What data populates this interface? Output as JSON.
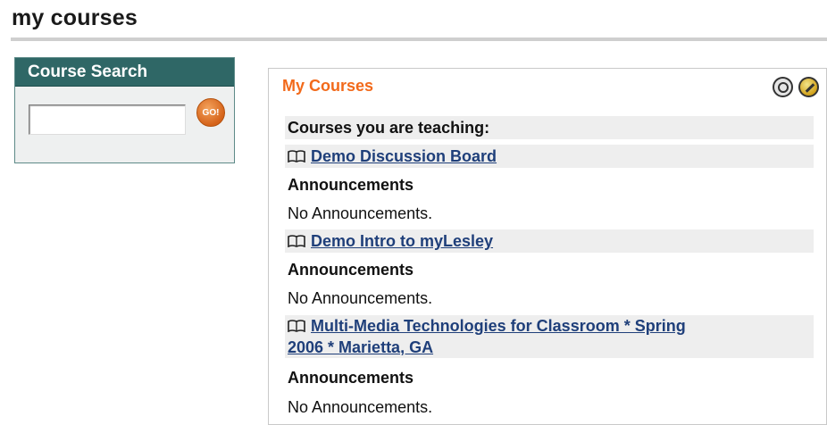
{
  "page": {
    "title": "my courses"
  },
  "search": {
    "header": "Course Search",
    "input_value": "",
    "input_placeholder": "",
    "go_label": "GO!"
  },
  "module": {
    "title": "My Courses",
    "section_heading": "Courses you are teaching:",
    "courses": [
      {
        "name": "Demo Discussion Board",
        "announcements_label": "Announcements",
        "announcements_text": "No Announcements."
      },
      {
        "name": "Demo Intro to myLesley",
        "announcements_label": "Announcements",
        "announcements_text": "No Announcements."
      },
      {
        "name_line1": "Multi-Media Technologies for Classroom * Spring",
        "name_line2": "2006 * Marietta, GA",
        "announcements_label": "Announcements",
        "announcements_text": "No Announcements."
      }
    ],
    "icons": {
      "manage": "manage-icon",
      "edit": "edit-icon",
      "course": "book-icon"
    }
  },
  "colors": {
    "accent_orange": "#f26a1b",
    "search_header": "#2f6766",
    "link": "#1f3f7a"
  }
}
